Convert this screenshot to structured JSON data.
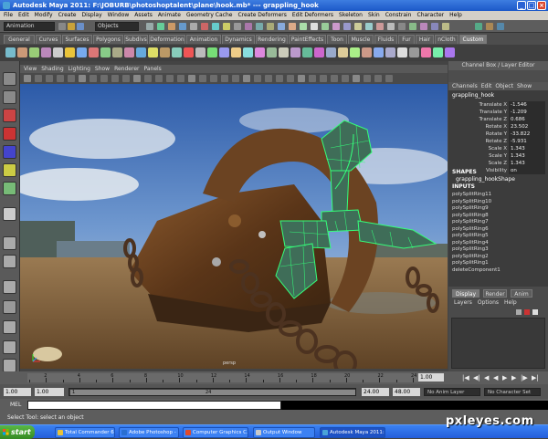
{
  "window": {
    "title": "Autodesk Maya 2011: F:\\JOBURB\\photoshoptalent\\plane\\hook.mb*   ---   grappling_hook"
  },
  "menubar": {
    "items": [
      "File",
      "Edit",
      "Modify",
      "Create",
      "Display",
      "Window",
      "Assets",
      "Animate",
      "Geometry Cache",
      "Create Deformers",
      "Edit Deformers",
      "Skeleton",
      "Skin",
      "Constrain",
      "Character",
      "Help"
    ]
  },
  "statusline": {
    "mode": "Animation",
    "selection_mode": "Objects"
  },
  "shelf": {
    "tabs": [
      "General",
      "Curves",
      "Surfaces",
      "Polygons",
      "Subdivs",
      "Deformation",
      "Animation",
      "Dynamics",
      "Rendering",
      "PaintEffects",
      "Toon",
      "Muscle",
      "Fluids",
      "Fur",
      "Hair",
      "nCloth",
      "Custom"
    ],
    "active_tab": "Custom"
  },
  "viewport": {
    "menu": [
      "View",
      "Shading",
      "Lighting",
      "Show",
      "Renderer",
      "Panels"
    ],
    "camera_label": "persp"
  },
  "channel_box": {
    "header": "Channel Box / Layer Editor",
    "menu": [
      "Channels",
      "Edit",
      "Object",
      "Show"
    ],
    "object_name": "grappling_hook",
    "channels": [
      {
        "name": "Translate X",
        "value": "-1.546"
      },
      {
        "name": "Translate Y",
        "value": "-1.209"
      },
      {
        "name": "Translate Z",
        "value": "0.686"
      },
      {
        "name": "Rotate X",
        "value": "23.502"
      },
      {
        "name": "Rotate Y",
        "value": "-33.822"
      },
      {
        "name": "Rotate Z",
        "value": "-5.931"
      },
      {
        "name": "Scale X",
        "value": "1.343"
      },
      {
        "name": "Scale Y",
        "value": "1.343"
      },
      {
        "name": "Scale Z",
        "value": "1.343"
      },
      {
        "name": "Visibility",
        "value": "on"
      }
    ],
    "shapes_label": "SHAPES",
    "shape_name": "grappling_hookShape",
    "inputs_label": "INPUTS",
    "inputs": [
      "polySplitRing11",
      "polySplitRing10",
      "polySplitRing9",
      "polySplitRing8",
      "polySplitRing7",
      "polySplitRing6",
      "polySplitRing5",
      "polySplitRing4",
      "polySplitRing3",
      "polySplitRing2",
      "polySplitRing1",
      "deleteComponent1"
    ]
  },
  "layer_editor": {
    "tabs": [
      "Display",
      "Render",
      "Anim"
    ],
    "active_tab": "Display",
    "menu": [
      "Layers",
      "Options",
      "Help"
    ]
  },
  "time_slider": {
    "ticks": [
      "2",
      "4",
      "6",
      "8",
      "10",
      "12",
      "14",
      "16",
      "18",
      "20",
      "22",
      "24"
    ],
    "current_frame": "1.00"
  },
  "range_slider": {
    "start_time": "1.00",
    "playback_start": "1.00",
    "range_start_label": "1",
    "range_end_label": "24",
    "playback_end": "24.00",
    "end_time": "48.00",
    "anim_layer": "No Anim Layer",
    "character_set": "No Character Set"
  },
  "command_line": {
    "label": "MEL"
  },
  "help_line": {
    "text": "Select Tool: select an object"
  },
  "taskbar": {
    "start_label": "start",
    "tasks": [
      {
        "label": "Total Commander 6.0...",
        "color": "#e8c23a"
      },
      {
        "label": "Adobe Photoshop - [...",
        "color": "#2a6fd1"
      },
      {
        "label": "Computer Graphics C...",
        "color": "#e04a2a"
      },
      {
        "label": "Output Window",
        "color": "#c9c9c9"
      },
      {
        "label": "Autodesk Maya 2011:...",
        "color": "#4aa3d8",
        "active": true
      }
    ]
  },
  "watermark": "pxleyes.com",
  "colors": {
    "titlebar": "#2a63d4",
    "wireframe": "#35ff7a",
    "taskbar": "#245edb",
    "start": "#3c9a2a"
  }
}
